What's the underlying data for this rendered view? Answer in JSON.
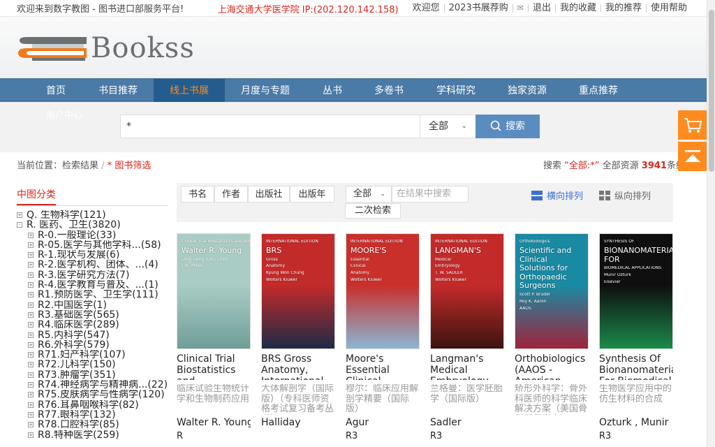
{
  "topbar": {
    "welcome": "欢迎来到数字教图 - 图书进口部服务平台!",
    "institution": "上海交通大学医学院 IP:(202.120.142.158)",
    "links": [
      "欢迎您",
      "2023书展荐购",
      "退出",
      "我的收藏",
      "我的推荐",
      "使用帮助"
    ]
  },
  "logo": {
    "text": "Bookss"
  },
  "nav": {
    "items": [
      "首页",
      "书目推荐",
      "线上书展",
      "月度与专题",
      "丛书",
      "多卷书",
      "学科研究",
      "独家资源",
      "重点推荐"
    ],
    "active": "线上书展",
    "user_center": "用户中心"
  },
  "search": {
    "value": "*",
    "scope": "全部",
    "button": "搜索"
  },
  "breadcrumb": {
    "label": "当前位置：",
    "step1": "检索结果",
    "sep": "/",
    "step2": "* 图书筛选"
  },
  "result": {
    "prefix": "搜索",
    "query": "“全部:*”",
    "middle": "全部资源",
    "count": "3941",
    "suffix": "条结果"
  },
  "sidebar": {
    "title": "中图分类",
    "tree": [
      {
        "sign": "+",
        "label": "Q. 生物科学(121)",
        "level": 0
      },
      {
        "sign": "-",
        "label": "R. 医药、卫生(3820)",
        "level": 0
      },
      {
        "sign": "+",
        "label": "R-0.一般理论(33)",
        "level": 1
      },
      {
        "sign": "+",
        "label": "R-05.医学与其他学科...(58)",
        "level": 1
      },
      {
        "sign": "+",
        "label": "R-1.现状与发展(6)",
        "level": 1
      },
      {
        "sign": "+",
        "label": "R-2.医学机构、团体、...(4)",
        "level": 1
      },
      {
        "sign": "+",
        "label": "R-3.医学研究方法(7)",
        "level": 1
      },
      {
        "sign": "+",
        "label": "R-4.医学教育与普及、...(1)",
        "level": 1
      },
      {
        "sign": "+",
        "label": "R1.预防医学、卫生学(111)",
        "level": 1
      },
      {
        "sign": "+",
        "label": "R2.中国医学(1)",
        "level": 1
      },
      {
        "sign": "+",
        "label": "R3.基础医学(565)",
        "level": 1
      },
      {
        "sign": "+",
        "label": "R4.临床医学(289)",
        "level": 1
      },
      {
        "sign": "+",
        "label": "R5.内科学(547)",
        "level": 1
      },
      {
        "sign": "+",
        "label": "R6.外科学(579)",
        "level": 1
      },
      {
        "sign": "+",
        "label": "R71.妇产科学(107)",
        "level": 1
      },
      {
        "sign": "+",
        "label": "R72.儿科学(150)",
        "level": 1
      },
      {
        "sign": "+",
        "label": "R73.肿瘤学(351)",
        "level": 1
      },
      {
        "sign": "+",
        "label": "R74.神经病学与精神病...(22)",
        "level": 1
      },
      {
        "sign": "+",
        "label": "R75.皮肤病学与性病学(120)",
        "level": 1
      },
      {
        "sign": "+",
        "label": "R76.耳鼻咽喉科学(82)",
        "level": 1
      },
      {
        "sign": "+",
        "label": "R77.眼科学(132)",
        "level": 1
      },
      {
        "sign": "+",
        "label": "R78.口腔科学(85)",
        "level": 1
      },
      {
        "sign": "+",
        "label": "R8.特种医学(259)",
        "level": 1
      }
    ]
  },
  "filter": {
    "tabs": [
      "书名",
      "作者",
      "出版社",
      "出版年"
    ],
    "scope": "全部",
    "placeholder": "在结果中搜索",
    "secondary": "二次检索",
    "view_horizontal": "横向排列",
    "view_vertical": "纵向排列"
  },
  "books": [
    {
      "title": "Clinical Trial Biostatistics and Biopharmaceutical Applications",
      "cn": "临床试验生物统计学和生物制药应用",
      "author": "Walter R. Young",
      "cls": "R",
      "cover_text": [
        "Clinical Trial Biostatistics and Biopharmaceutical Applications",
        "Walter R. Young",
        "Ding-Geng (Din) Chen",
        "CRC Press"
      ],
      "colors": [
        "#a9ccc4",
        "#6f9e98"
      ]
    },
    {
      "title": "BRS Gross Anatomy, International Edition",
      "cn": "大体解剖学（国际版）（专科医师资格考试复习备考丛书）",
      "author": "Halliday",
      "cls": "",
      "cover_text": [
        "INTERNATIONAL EDITION",
        "BRS",
        "Gross",
        "Anatomy",
        "Kyung Won Chung",
        "Wolters Kluwer"
      ],
      "colors": [
        "#c32a2a",
        "#1d2b47"
      ]
    },
    {
      "title": "Moore's Essential Clinical Anatomy",
      "cn": "穆尔：临床应用解剖学精要（国际版）",
      "author": "Agur",
      "cls": "R3",
      "cover_text": [
        "INTERNATIONAL EDITION",
        "MOORE'S",
        "Essential",
        "Clinical",
        "Anatomy",
        "Wolters Kluwer"
      ],
      "colors": [
        "#c9302c",
        "#8ab6d6"
      ]
    },
    {
      "title": "Langman's Medical Embryology",
      "cn": "兰格曼：医学胚胎学（国际版）",
      "author": "Sadler",
      "cls": "R3",
      "cover_text": [
        "INTERNATIONAL EDITION",
        "LANGMAN'S",
        "Medical",
        "Embryology",
        "T. W. SADLER",
        "Wolters Kluwer"
      ],
      "colors": [
        "#c32a2a",
        "#3b1410"
      ]
    },
    {
      "title": "Orthobiologics (AAOS - American Academy of Orthopaedic Surgeons)",
      "cn": "矫形外科学：骨外科医师的科学临床解决方案（美国骨科医师学会）",
      "author": "",
      "cls": "",
      "cover_text": [
        "Orthobiologics",
        "Scientific and Clinical Solutions for Orthopaedic Surgeons",
        "Scott P. Bruder",
        "Roy K. Aaron",
        "AAOS"
      ],
      "colors": [
        "#1a8aa3",
        "#a0233b"
      ]
    },
    {
      "title": "Synthesis Of Bionanomaterials For Biomedical Applications",
      "cn": "生物医学应用中的仿生材料的合成",
      "author": "Ozturk , Munir",
      "cls": "R3",
      "cover_text": [
        "SYNTHESIS OF",
        "BIONANOMATERIALS FOR",
        "BIOMEDICAL APPLICATIONS",
        "Munir Ozturk",
        "Elsevier"
      ],
      "colors": [
        "#0f0f0f",
        "#1b8a4a"
      ]
    }
  ],
  "colors": {
    "accent": "#d9251c",
    "nav": "#4a7aa6",
    "nav_active": "#245c8d",
    "orange": "#ff8b1f",
    "button": "#5a8cc0"
  }
}
